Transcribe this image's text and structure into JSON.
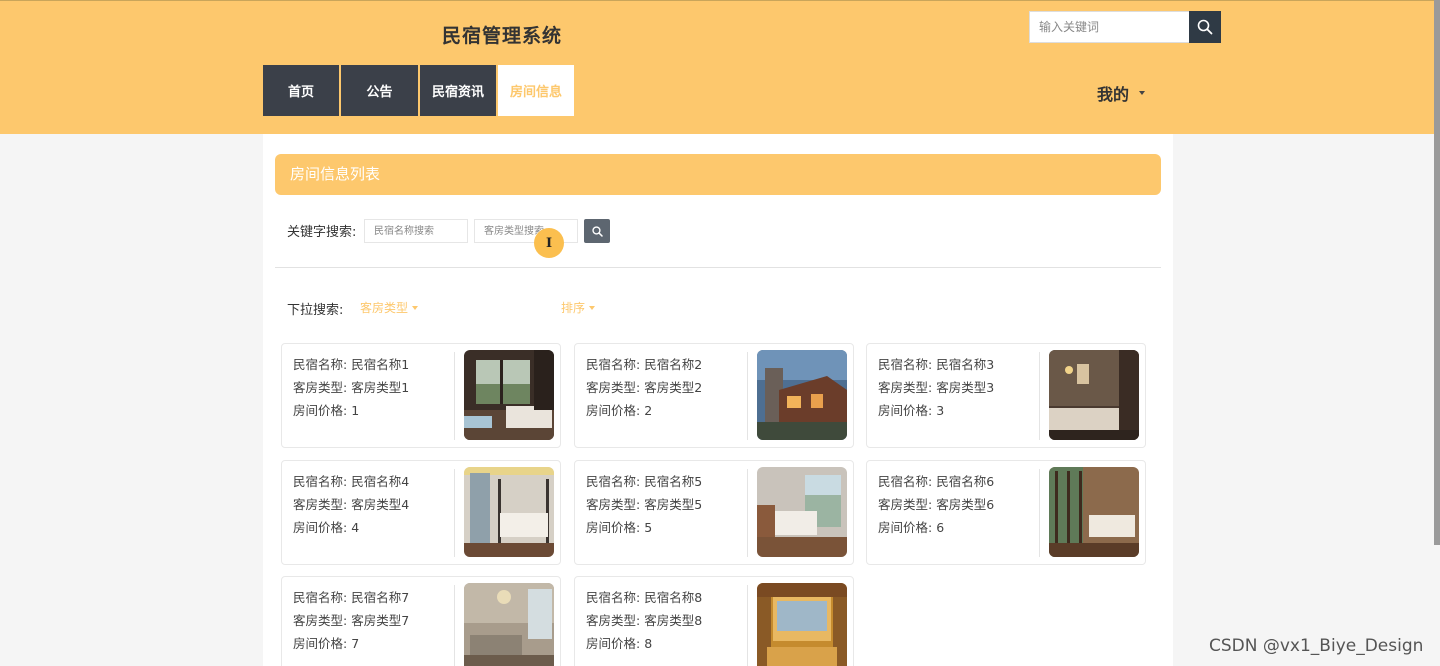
{
  "header": {
    "site_title": "民宿管理系统",
    "search_placeholder": "输入关键词",
    "nav": [
      {
        "label": "首页"
      },
      {
        "label": "公告"
      },
      {
        "label": "民宿资讯"
      },
      {
        "label": "房间信息",
        "active": true
      }
    ],
    "mine_label": "我的"
  },
  "main": {
    "panel_title": "房间信息列表",
    "keyword_label": "关键字搜索:",
    "name_placeholder": "民宿名称搜索",
    "type_placeholder": "客房类型搜索",
    "dropdown_label": "下拉搜索:",
    "type_dropdown": "客房类型",
    "sort_dropdown": "排序"
  },
  "card_labels": {
    "name": "民宿名称: ",
    "type": "客房类型: ",
    "price": "房间价格: "
  },
  "cards": [
    {
      "name": "民宿名称1",
      "type": "客房类型1",
      "price": "1"
    },
    {
      "name": "民宿名称2",
      "type": "客房类型2",
      "price": "2"
    },
    {
      "name": "民宿名称3",
      "type": "客房类型3",
      "price": "3"
    },
    {
      "name": "民宿名称4",
      "type": "客房类型4",
      "price": "4"
    },
    {
      "name": "民宿名称5",
      "type": "客房类型5",
      "price": "5"
    },
    {
      "name": "民宿名称6",
      "type": "客房类型6",
      "price": "6"
    },
    {
      "name": "民宿名称7",
      "type": "客房类型7",
      "price": "7"
    },
    {
      "name": "民宿名称8",
      "type": "客房类型8",
      "price": "8"
    }
  ],
  "watermark": "CSDN @vx1_Biye_Design",
  "colors": {
    "accent": "#fdc86d",
    "nav_dark": "#3b4049",
    "search_button": "#2f3a45"
  },
  "icons": {
    "search": "search-icon",
    "dropdown": "caret-down-icon",
    "cursor": "text-cursor-icon"
  }
}
